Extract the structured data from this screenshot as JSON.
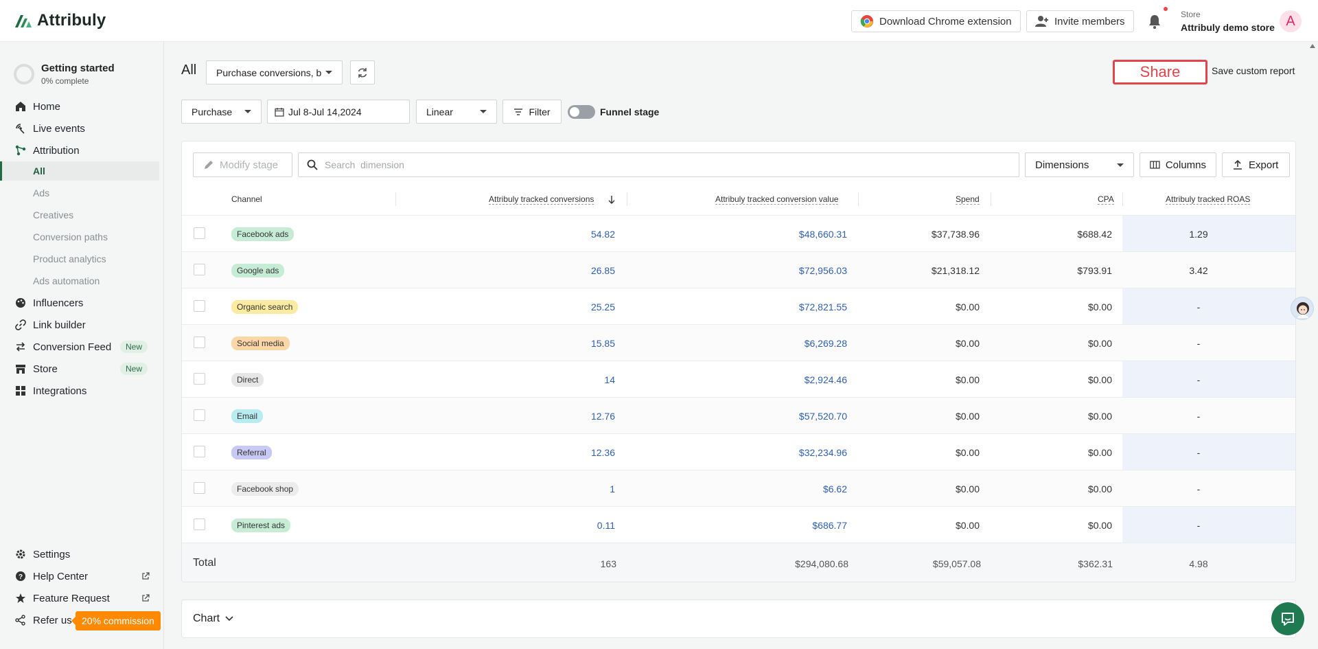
{
  "topbar": {
    "logo": "Attribuly",
    "chrome_ext_label": "Download Chrome extension",
    "invite_label": "Invite members",
    "store_label": "Store",
    "store_name": "Attribuly demo store",
    "avatar_letter": "A"
  },
  "sidebar": {
    "getting_started": {
      "title": "Getting started",
      "progress": "0% complete"
    },
    "items": [
      {
        "label": "Home",
        "icon": "home-icon"
      },
      {
        "label": "Live events",
        "icon": "live-events-icon"
      },
      {
        "label": "Attribution",
        "icon": "attribution-icon"
      },
      {
        "label": "All",
        "sub": true,
        "active": true
      },
      {
        "label": "Ads",
        "sub": true
      },
      {
        "label": "Creatives",
        "sub": true
      },
      {
        "label": "Conversion paths",
        "sub": true
      },
      {
        "label": "Product analytics",
        "sub": true
      },
      {
        "label": "Ads automation",
        "sub": true
      },
      {
        "label": "Influencers",
        "icon": "influencers-icon"
      },
      {
        "label": "Link builder",
        "icon": "link-icon"
      },
      {
        "label": "Conversion Feed",
        "icon": "conversion-feed-icon",
        "badge": "New"
      },
      {
        "label": "Store",
        "icon": "store-icon",
        "badge": "New"
      },
      {
        "label": "Integrations",
        "icon": "integrations-icon"
      }
    ],
    "bottom": {
      "settings": "Settings",
      "help_center": "Help Center",
      "feature_request": "Feature Request",
      "refer_us": "Refer us",
      "commission": "20% commission"
    }
  },
  "header": {
    "title": "All",
    "conversion_select": "Purchase conversions, b",
    "share_label": "Share",
    "save_custom_report": "Save custom report"
  },
  "filters": {
    "event": "Purchase",
    "date_range": "Jul 8-Jul 14,2024",
    "model": "Linear",
    "filter_label": "Filter",
    "funnel_stage_label": "Funnel stage",
    "funnel_stage_on": false
  },
  "toolbar": {
    "modify_stage": "Modify stage",
    "search_placeholder": "Search  dimension",
    "dimensions": "Dimensions",
    "columns": "Columns",
    "export": "Export"
  },
  "table": {
    "columns": [
      "Channel",
      "Attribuly tracked conversions",
      "Attribuly tracked conversion value",
      "Spend",
      "CPA",
      "Attribuly tracked ROAS"
    ],
    "rows": [
      {
        "channel": "Facebook ads",
        "tag_color": "#c6ecd6",
        "conversions": "54.82",
        "value": "$48,660.31",
        "spend": "$37,738.96",
        "cpa": "$688.42",
        "roas": "1.29"
      },
      {
        "channel": "Google ads",
        "tag_color": "#c6ecd6",
        "conversions": "26.85",
        "value": "$72,956.03",
        "spend": "$21,318.12",
        "cpa": "$793.91",
        "roas": "3.42"
      },
      {
        "channel": "Organic search",
        "tag_color": "#fbeaa1",
        "conversions": "25.25",
        "value": "$72,821.55",
        "spend": "$0.00",
        "cpa": "$0.00",
        "roas": "-"
      },
      {
        "channel": "Social media",
        "tag_color": "#fbd6a6",
        "conversions": "15.85",
        "value": "$6,269.28",
        "spend": "$0.00",
        "cpa": "$0.00",
        "roas": "-"
      },
      {
        "channel": "Direct",
        "tag_color": "#e6e6e6",
        "conversions": "14",
        "value": "$2,924.46",
        "spend": "$0.00",
        "cpa": "$0.00",
        "roas": "-"
      },
      {
        "channel": "Email",
        "tag_color": "#b8ecf1",
        "conversions": "12.76",
        "value": "$57,520.70",
        "spend": "$0.00",
        "cpa": "$0.00",
        "roas": "-"
      },
      {
        "channel": "Referral",
        "tag_color": "#c9c9f5",
        "conversions": "12.36",
        "value": "$32,234.96",
        "spend": "$0.00",
        "cpa": "$0.00",
        "roas": "-"
      },
      {
        "channel": "Facebook shop",
        "tag_color": "#ececec",
        "conversions": "1",
        "value": "$6.62",
        "spend": "$0.00",
        "cpa": "$0.00",
        "roas": "-"
      },
      {
        "channel": "Pinterest ads",
        "tag_color": "#c6ecd6",
        "conversions": "0.11",
        "value": "$686.77",
        "spend": "$0.00",
        "cpa": "$0.00",
        "roas": "-"
      }
    ],
    "total": {
      "label": "Total",
      "conversions": "163",
      "value": "$294,080.68",
      "spend": "$59,057.08",
      "cpa": "$362.31",
      "roas": "4.98"
    }
  },
  "chart_section": {
    "label": "Chart"
  },
  "colors": {
    "brand": "#1f6b45",
    "link": "#2f5fb0",
    "accent_orange": "#ff8a00",
    "share_red": "#e0454b"
  }
}
